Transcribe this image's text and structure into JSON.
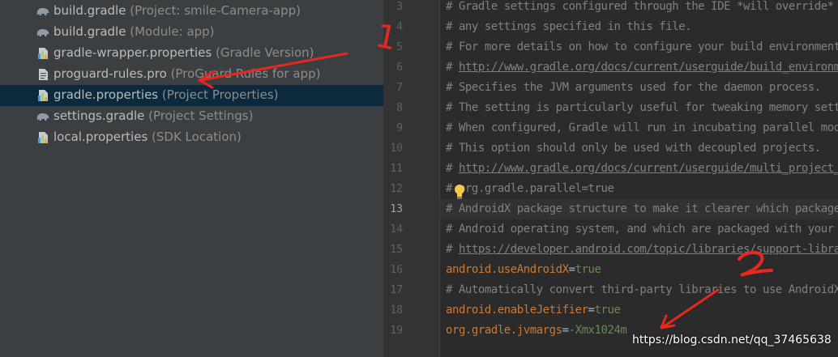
{
  "project_tree": [
    {
      "name": "build.gradle",
      "hint": "(Project: smile-Camera-app)",
      "icon": "gradle-elephant-icon",
      "selected": false
    },
    {
      "name": "build.gradle",
      "hint": "(Module: app)",
      "icon": "gradle-elephant-icon",
      "selected": false
    },
    {
      "name": "gradle-wrapper.properties",
      "hint": "(Gradle Version)",
      "icon": "properties-file-icon",
      "selected": false
    },
    {
      "name": "proguard-rules.pro",
      "hint": "(ProGuard Rules for app)",
      "icon": "text-file-icon",
      "selected": false
    },
    {
      "name": "gradle.properties",
      "hint": "(Project Properties)",
      "icon": "properties-file-icon",
      "selected": true
    },
    {
      "name": "settings.gradle",
      "hint": "(Project Settings)",
      "icon": "gradle-elephant-icon",
      "selected": false
    },
    {
      "name": "local.properties",
      "hint": "(SDK Location)",
      "icon": "properties-file-icon",
      "selected": false
    }
  ],
  "editor": {
    "current_line": 13,
    "lines": [
      {
        "num": "3",
        "parts": [
          {
            "type": "comment",
            "text": "# Gradle settings configured through the IDE *will override*"
          }
        ]
      },
      {
        "num": "4",
        "parts": [
          {
            "type": "comment",
            "text": "# any settings specified in this file."
          }
        ]
      },
      {
        "num": "5",
        "parts": [
          {
            "type": "comment",
            "text": "# For more details on how to configure your build environment visit"
          }
        ]
      },
      {
        "num": "6",
        "parts": [
          {
            "type": "comment",
            "text": "# "
          },
          {
            "type": "url",
            "text": "http://www.gradle.org/docs/current/userguide/build_environment.html"
          }
        ]
      },
      {
        "num": "7",
        "parts": [
          {
            "type": "comment",
            "text": "# Specifies the JVM arguments used for the daemon process."
          }
        ]
      },
      {
        "num": "8",
        "parts": [
          {
            "type": "comment",
            "text": "# The setting is particularly useful for tweaking memory settings."
          }
        ]
      },
      {
        "num": "9",
        "parts": [
          {
            "type": "comment",
            "text": "# When configured, Gradle will run in incubating parallel mode."
          }
        ]
      },
      {
        "num": "10",
        "parts": [
          {
            "type": "comment",
            "text": "# This option should only be used with decoupled projects."
          }
        ]
      },
      {
        "num": "11",
        "parts": [
          {
            "type": "comment",
            "text": "# "
          },
          {
            "type": "url",
            "text": "http://www.gradle.org/docs/current/userguide/multi_project_builds.html"
          }
        ]
      },
      {
        "num": "12",
        "parts": [
          {
            "type": "comment",
            "text": "# org.gradle.parallel=true"
          }
        ]
      },
      {
        "num": "13",
        "parts": [
          {
            "type": "comment",
            "text": "# AndroidX package structure to make it clearer which packages are bundled with the"
          }
        ]
      },
      {
        "num": "14",
        "parts": [
          {
            "type": "comment",
            "text": "# Android operating system, and which are packaged with your app's APK"
          }
        ]
      },
      {
        "num": "15",
        "parts": [
          {
            "type": "comment",
            "text": "# "
          },
          {
            "type": "url",
            "text": "https://developer.android.com/topic/libraries/support-library/androidx-rn"
          }
        ]
      },
      {
        "num": "16",
        "parts": [
          {
            "type": "key",
            "text": "android.useAndroidX"
          },
          {
            "type": "eq",
            "text": "="
          },
          {
            "type": "val",
            "text": "true"
          }
        ]
      },
      {
        "num": "17",
        "parts": [
          {
            "type": "comment",
            "text": "# Automatically convert third-party libraries to use AndroidX"
          }
        ]
      },
      {
        "num": "18",
        "parts": [
          {
            "type": "key",
            "text": "android.enableJetifier"
          },
          {
            "type": "eq",
            "text": "="
          },
          {
            "type": "val",
            "text": "true"
          }
        ]
      },
      {
        "num": "19",
        "parts": [
          {
            "type": "key",
            "text": "org.gradle.jvmargs"
          },
          {
            "type": "eq",
            "text": "="
          },
          {
            "type": "val",
            "text": "-Xmx1024m"
          }
        ]
      }
    ]
  },
  "annotations": {
    "marker_1": "1",
    "marker_2": "2",
    "color": "#e8281e"
  },
  "watermark": "https://blog.csdn.net/qq_37465638",
  "colors": {
    "sidebar_bg": "#3c3f41",
    "selection_bg": "#0d293e",
    "editor_bg": "#2b2b2b",
    "comment": "#808080",
    "key": "#cc7832",
    "value": "#6a8759"
  }
}
